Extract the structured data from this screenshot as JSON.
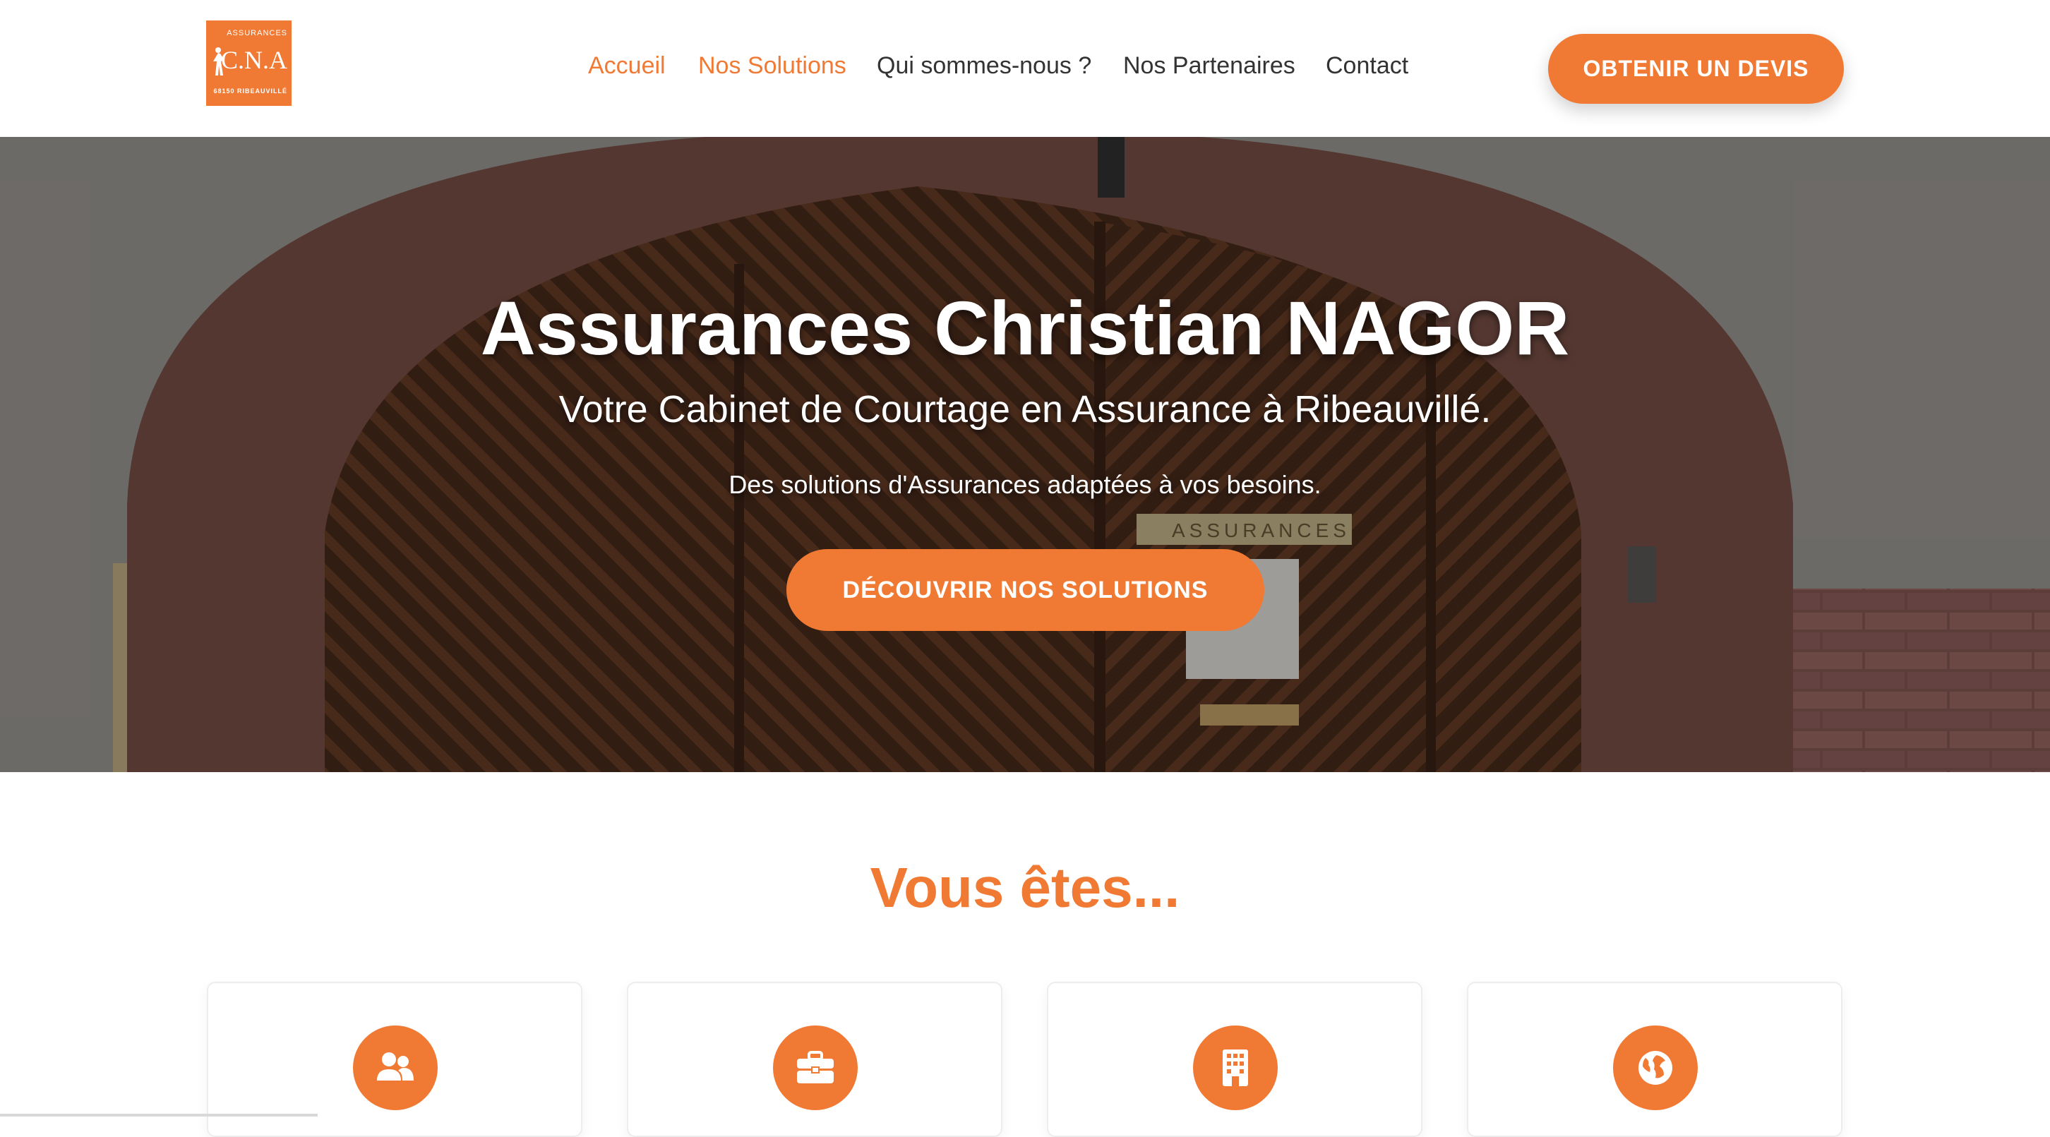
{
  "header": {
    "logo": {
      "top_text": "ASSURANCES",
      "main_text": "C.N.A",
      "bottom_text": "68150 RIBEAUVILLÉ",
      "color": "#f07a33"
    },
    "nav": [
      {
        "label": "Accueil",
        "active": true
      },
      {
        "label": "Nos Solutions",
        "active": true
      },
      {
        "label": "Qui sommes-nous ?",
        "active": false
      },
      {
        "label": "Nos Partenaires",
        "active": false
      },
      {
        "label": "Contact",
        "active": false
      }
    ],
    "cta_label": "OBTENIR UN DEVIS"
  },
  "hero": {
    "title": "Assurances Christian NAGOR",
    "subtitle": "Votre Cabinet de Courtage en Assurance à Ribeauvillé.",
    "tagline": "Des solutions d'Assurances adaptées à vos besoins.",
    "button_label": "DÉCOUVRIR NOS SOLUTIONS",
    "sign_text": "ASSURANCES"
  },
  "section": {
    "title": "Vous êtes...",
    "cards": [
      {
        "icon": "users-icon"
      },
      {
        "icon": "briefcase-icon"
      },
      {
        "icon": "building-icon"
      },
      {
        "icon": "globe-icon"
      }
    ]
  },
  "colors": {
    "accent": "#f07a33",
    "text": "#333333"
  }
}
